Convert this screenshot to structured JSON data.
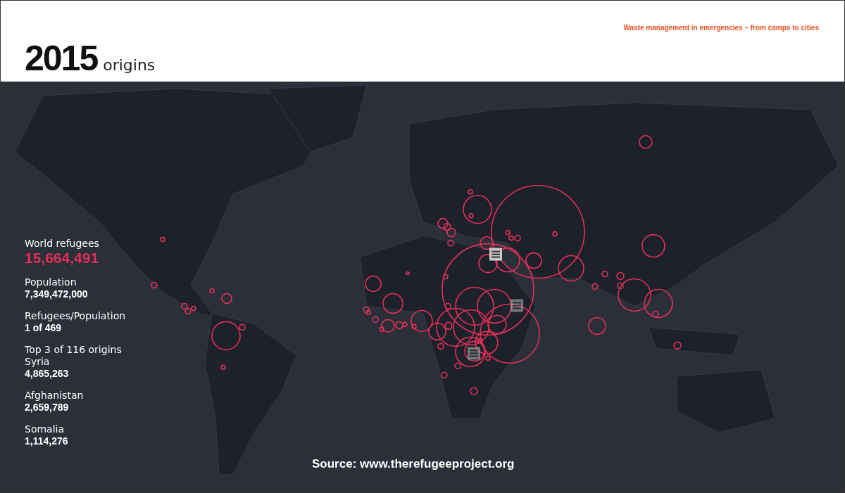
{
  "header": {
    "year": "2015",
    "subtitle": "origins",
    "tagline": "Waste management in emergencies – from camps to cities"
  },
  "stats": [
    {
      "lines": [
        {
          "kind": "label",
          "text": "World refugees"
        },
        {
          "kind": "highlight",
          "text": "15,664,491"
        }
      ]
    },
    {
      "lines": [
        {
          "kind": "label",
          "text": "Population"
        },
        {
          "kind": "value",
          "text": "7,349,472,000"
        }
      ]
    },
    {
      "lines": [
        {
          "kind": "label",
          "text": "Refugees/Population"
        },
        {
          "kind": "value",
          "text": "1 of 469"
        }
      ]
    },
    {
      "lines": [
        {
          "kind": "label",
          "text": "Top 3 of 116 origins"
        },
        {
          "kind": "label",
          "text": "Syria"
        },
        {
          "kind": "value",
          "text": "4,865,263"
        }
      ]
    },
    {
      "lines": [
        {
          "kind": "label",
          "text": "Afghanistan"
        },
        {
          "kind": "value",
          "text": "2,659,789"
        }
      ]
    },
    {
      "lines": [
        {
          "kind": "label",
          "text": "Somalia"
        },
        {
          "kind": "value",
          "text": "1,114,276"
        }
      ]
    }
  ],
  "source": "Source: www.therefugeeproject.org"
}
